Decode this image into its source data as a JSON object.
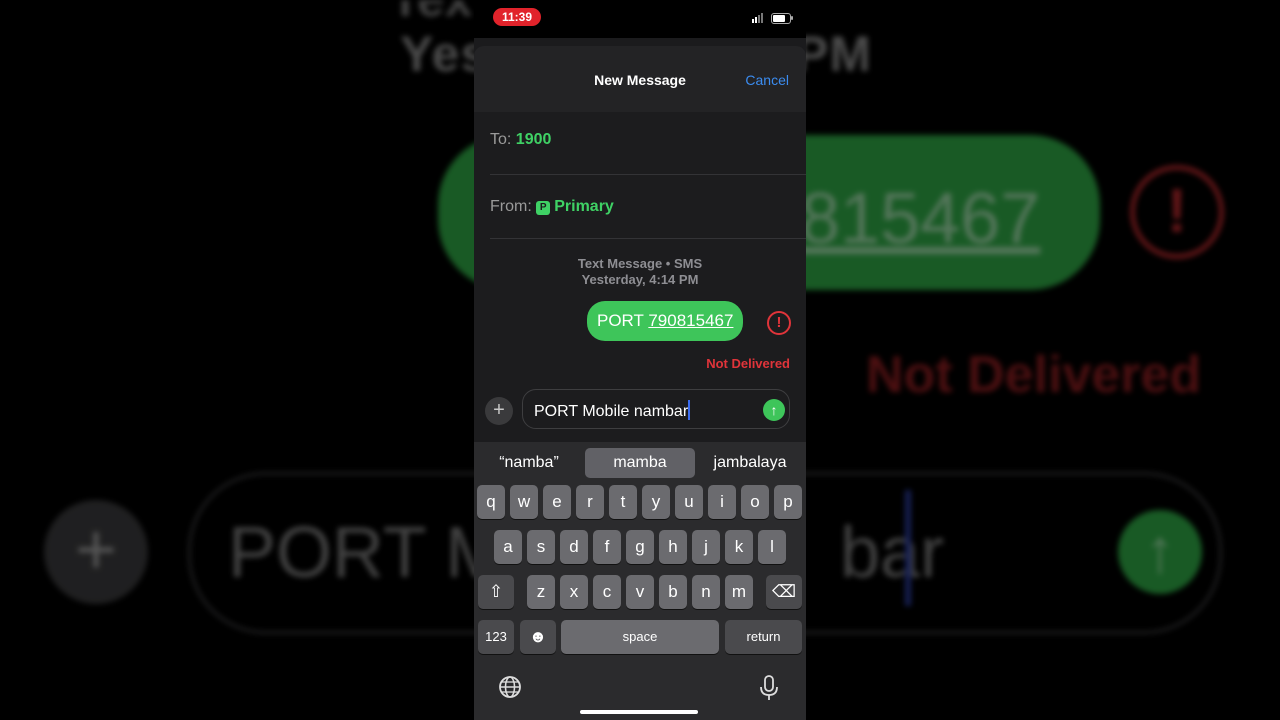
{
  "status": {
    "time": "11:39"
  },
  "nav": {
    "title": "New Message",
    "cancel": "Cancel"
  },
  "to": {
    "label": "To:",
    "value": "1900"
  },
  "from": {
    "label": "From:",
    "badge": "P",
    "value": "Primary"
  },
  "thread": {
    "service": "Text Message • SMS",
    "timestamp": "Yesterday, 4:14 PM",
    "message_prefix": "PORT ",
    "message_number": "790815467",
    "error_glyph": "!",
    "delivery_status": "Not Delivered"
  },
  "composer": {
    "text": "PORT Mobile nambar",
    "plus_glyph": "+",
    "send_glyph": "↑"
  },
  "keyboard": {
    "suggestions": [
      "“namba”",
      "mamba",
      "jambalaya"
    ],
    "row1": [
      "q",
      "w",
      "e",
      "r",
      "t",
      "y",
      "u",
      "i",
      "o",
      "p"
    ],
    "row2": [
      "a",
      "s",
      "d",
      "f",
      "g",
      "h",
      "j",
      "k",
      "l"
    ],
    "row3": [
      "z",
      "x",
      "c",
      "v",
      "b",
      "n",
      "m"
    ],
    "numbers_key": "123",
    "space_key": "space",
    "return_key": "return",
    "shift_glyph": "⇧",
    "delete_glyph": "⌫",
    "emoji_glyph": "☻",
    "icons": [
      "globe-icon",
      "microphone-icon"
    ]
  },
  "background": {
    "time_fragment": "Tex",
    "sub_left": "Yes",
    "sub_right": "PM",
    "number_fragment": "815467",
    "input_left": "PORT M",
    "input_right": "bar",
    "delivery_status": "Not Delivered"
  },
  "colors": {
    "accent": "#3b8cf0",
    "bubble": "#3ec55a",
    "error": "#e0343a",
    "status_pill": "#e1232b"
  }
}
